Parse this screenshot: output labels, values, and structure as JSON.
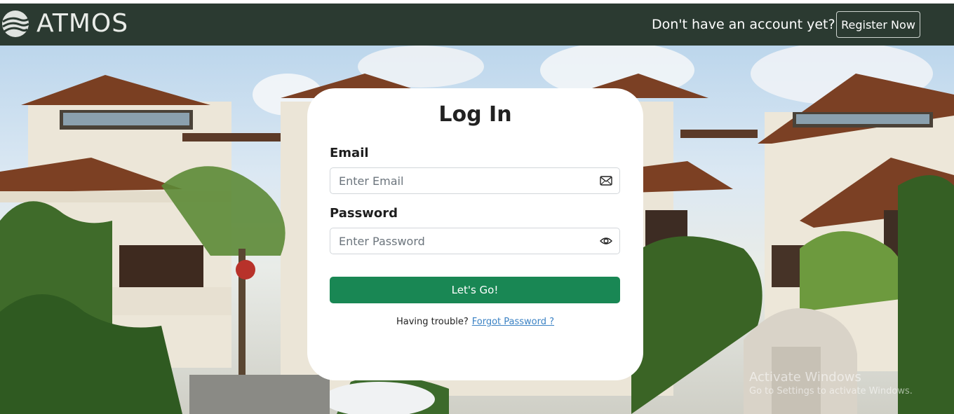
{
  "brand": {
    "name": "ATMOS"
  },
  "navbar": {
    "question": "Don't have an account yet?",
    "register_label": "Register Now",
    "background": "#2b3a31"
  },
  "login": {
    "title": "Log In",
    "email_label": "Email",
    "email_placeholder": "Enter Email",
    "email_icon": "envelope-icon",
    "password_label": "Password",
    "password_placeholder": "Enter Password",
    "password_icon": "eye-icon",
    "submit_label": "Let's Go!",
    "submit_color": "#198754",
    "trouble_text": "Having trouble?",
    "forgot_label": "Forgot Password ?"
  },
  "watermark": {
    "line1": "Activate Windows",
    "line2": "Go to Settings to activate Windows."
  }
}
